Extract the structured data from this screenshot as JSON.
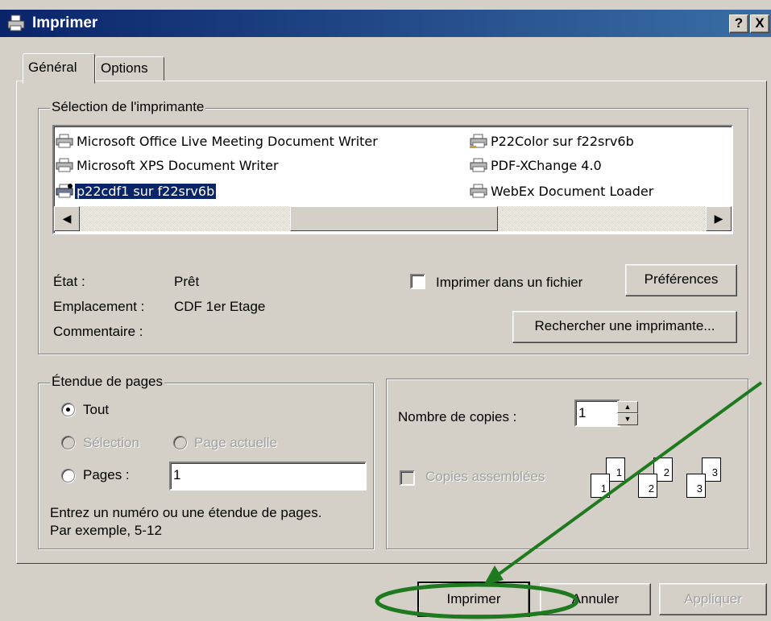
{
  "window": {
    "title": "Imprimer",
    "help_btn": "?",
    "close_btn": "X"
  },
  "tabs": [
    {
      "label": "Général"
    },
    {
      "label": "Options"
    }
  ],
  "printer_section": {
    "label": "Sélection de l'imprimante",
    "printers": [
      {
        "name": "Microsoft Office Live Meeting Document Writer"
      },
      {
        "name": "Microsoft XPS Document Writer"
      },
      {
        "name": "p22cdf1 sur f22srv6b",
        "selected": true
      },
      {
        "name": "P22Color sur f22srv6b"
      },
      {
        "name": "PDF-XChange 4.0"
      },
      {
        "name": "WebEx Document Loader"
      }
    ],
    "scroll_left": "◀",
    "scroll_right": "▶",
    "status_label": "État :",
    "status_value": "Prêt",
    "location_label": "Emplacement :",
    "location_value": "CDF 1er Etage",
    "comment_label": "Commentaire :",
    "print_to_file_label": "Imprimer dans un fichier",
    "preferences_btn": "Préférences",
    "find_printer_btn": "Rechercher une imprimante..."
  },
  "page_range": {
    "label": "Étendue de pages",
    "all_label": "Tout",
    "selection_label": "Sélection",
    "current_page_label": "Page actuelle",
    "pages_label": "Pages :",
    "pages_value": "1",
    "hint": "Entrez un numéro ou une étendue de pages.",
    "hint2": "Par exemple, 5-12"
  },
  "copies": {
    "count_label": "Nombre de copies :",
    "count_value": "1",
    "spin_up": "▲",
    "spin_down": "▼",
    "collate_label": "Copies assemblées",
    "page_numbers": [
      "1",
      "1",
      "2",
      "2",
      "3",
      "3"
    ]
  },
  "buttons": {
    "print": "Imprimer",
    "cancel": "Annuler",
    "apply": "Appliquer"
  },
  "colors": {
    "titlebar": "#0a246a",
    "face": "#d4d0c8",
    "selection": "#0a246a",
    "annotation": "#1f7a1f"
  }
}
